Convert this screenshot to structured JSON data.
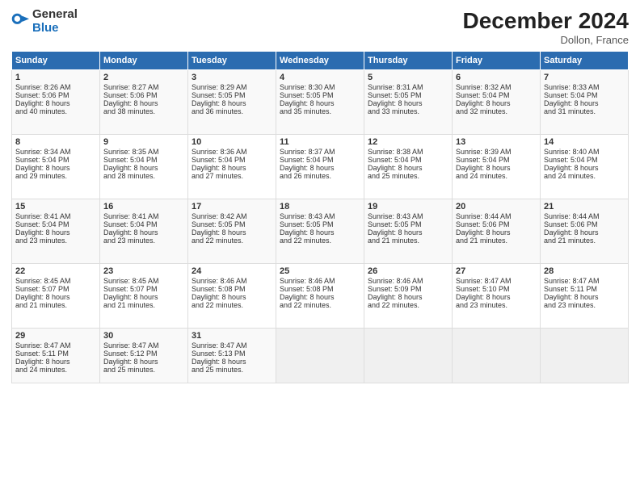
{
  "logo": {
    "general": "General",
    "blue": "Blue"
  },
  "title": "December 2024",
  "location": "Dollon, France",
  "days_of_week": [
    "Sunday",
    "Monday",
    "Tuesday",
    "Wednesday",
    "Thursday",
    "Friday",
    "Saturday"
  ],
  "weeks": [
    [
      {
        "day": "1",
        "lines": [
          "Sunrise: 8:26 AM",
          "Sunset: 5:06 PM",
          "Daylight: 8 hours",
          "and 40 minutes."
        ]
      },
      {
        "day": "2",
        "lines": [
          "Sunrise: 8:27 AM",
          "Sunset: 5:06 PM",
          "Daylight: 8 hours",
          "and 38 minutes."
        ]
      },
      {
        "day": "3",
        "lines": [
          "Sunrise: 8:29 AM",
          "Sunset: 5:05 PM",
          "Daylight: 8 hours",
          "and 36 minutes."
        ]
      },
      {
        "day": "4",
        "lines": [
          "Sunrise: 8:30 AM",
          "Sunset: 5:05 PM",
          "Daylight: 8 hours",
          "and 35 minutes."
        ]
      },
      {
        "day": "5",
        "lines": [
          "Sunrise: 8:31 AM",
          "Sunset: 5:05 PM",
          "Daylight: 8 hours",
          "and 33 minutes."
        ]
      },
      {
        "day": "6",
        "lines": [
          "Sunrise: 8:32 AM",
          "Sunset: 5:04 PM",
          "Daylight: 8 hours",
          "and 32 minutes."
        ]
      },
      {
        "day": "7",
        "lines": [
          "Sunrise: 8:33 AM",
          "Sunset: 5:04 PM",
          "Daylight: 8 hours",
          "and 31 minutes."
        ]
      }
    ],
    [
      {
        "day": "8",
        "lines": [
          "Sunrise: 8:34 AM",
          "Sunset: 5:04 PM",
          "Daylight: 8 hours",
          "and 29 minutes."
        ]
      },
      {
        "day": "9",
        "lines": [
          "Sunrise: 8:35 AM",
          "Sunset: 5:04 PM",
          "Daylight: 8 hours",
          "and 28 minutes."
        ]
      },
      {
        "day": "10",
        "lines": [
          "Sunrise: 8:36 AM",
          "Sunset: 5:04 PM",
          "Daylight: 8 hours",
          "and 27 minutes."
        ]
      },
      {
        "day": "11",
        "lines": [
          "Sunrise: 8:37 AM",
          "Sunset: 5:04 PM",
          "Daylight: 8 hours",
          "and 26 minutes."
        ]
      },
      {
        "day": "12",
        "lines": [
          "Sunrise: 8:38 AM",
          "Sunset: 5:04 PM",
          "Daylight: 8 hours",
          "and 25 minutes."
        ]
      },
      {
        "day": "13",
        "lines": [
          "Sunrise: 8:39 AM",
          "Sunset: 5:04 PM",
          "Daylight: 8 hours",
          "and 24 minutes."
        ]
      },
      {
        "day": "14",
        "lines": [
          "Sunrise: 8:40 AM",
          "Sunset: 5:04 PM",
          "Daylight: 8 hours",
          "and 24 minutes."
        ]
      }
    ],
    [
      {
        "day": "15",
        "lines": [
          "Sunrise: 8:41 AM",
          "Sunset: 5:04 PM",
          "Daylight: 8 hours",
          "and 23 minutes."
        ]
      },
      {
        "day": "16",
        "lines": [
          "Sunrise: 8:41 AM",
          "Sunset: 5:04 PM",
          "Daylight: 8 hours",
          "and 23 minutes."
        ]
      },
      {
        "day": "17",
        "lines": [
          "Sunrise: 8:42 AM",
          "Sunset: 5:05 PM",
          "Daylight: 8 hours",
          "and 22 minutes."
        ]
      },
      {
        "day": "18",
        "lines": [
          "Sunrise: 8:43 AM",
          "Sunset: 5:05 PM",
          "Daylight: 8 hours",
          "and 22 minutes."
        ]
      },
      {
        "day": "19",
        "lines": [
          "Sunrise: 8:43 AM",
          "Sunset: 5:05 PM",
          "Daylight: 8 hours",
          "and 21 minutes."
        ]
      },
      {
        "day": "20",
        "lines": [
          "Sunrise: 8:44 AM",
          "Sunset: 5:06 PM",
          "Daylight: 8 hours",
          "and 21 minutes."
        ]
      },
      {
        "day": "21",
        "lines": [
          "Sunrise: 8:44 AM",
          "Sunset: 5:06 PM",
          "Daylight: 8 hours",
          "and 21 minutes."
        ]
      }
    ],
    [
      {
        "day": "22",
        "lines": [
          "Sunrise: 8:45 AM",
          "Sunset: 5:07 PM",
          "Daylight: 8 hours",
          "and 21 minutes."
        ]
      },
      {
        "day": "23",
        "lines": [
          "Sunrise: 8:45 AM",
          "Sunset: 5:07 PM",
          "Daylight: 8 hours",
          "and 21 minutes."
        ]
      },
      {
        "day": "24",
        "lines": [
          "Sunrise: 8:46 AM",
          "Sunset: 5:08 PM",
          "Daylight: 8 hours",
          "and 22 minutes."
        ]
      },
      {
        "day": "25",
        "lines": [
          "Sunrise: 8:46 AM",
          "Sunset: 5:08 PM",
          "Daylight: 8 hours",
          "and 22 minutes."
        ]
      },
      {
        "day": "26",
        "lines": [
          "Sunrise: 8:46 AM",
          "Sunset: 5:09 PM",
          "Daylight: 8 hours",
          "and 22 minutes."
        ]
      },
      {
        "day": "27",
        "lines": [
          "Sunrise: 8:47 AM",
          "Sunset: 5:10 PM",
          "Daylight: 8 hours",
          "and 23 minutes."
        ]
      },
      {
        "day": "28",
        "lines": [
          "Sunrise: 8:47 AM",
          "Sunset: 5:11 PM",
          "Daylight: 8 hours",
          "and 23 minutes."
        ]
      }
    ],
    [
      {
        "day": "29",
        "lines": [
          "Sunrise: 8:47 AM",
          "Sunset: 5:11 PM",
          "Daylight: 8 hours",
          "and 24 minutes."
        ]
      },
      {
        "day": "30",
        "lines": [
          "Sunrise: 8:47 AM",
          "Sunset: 5:12 PM",
          "Daylight: 8 hours",
          "and 25 minutes."
        ]
      },
      {
        "day": "31",
        "lines": [
          "Sunrise: 8:47 AM",
          "Sunset: 5:13 PM",
          "Daylight: 8 hours",
          "and 25 minutes."
        ]
      },
      null,
      null,
      null,
      null
    ]
  ]
}
